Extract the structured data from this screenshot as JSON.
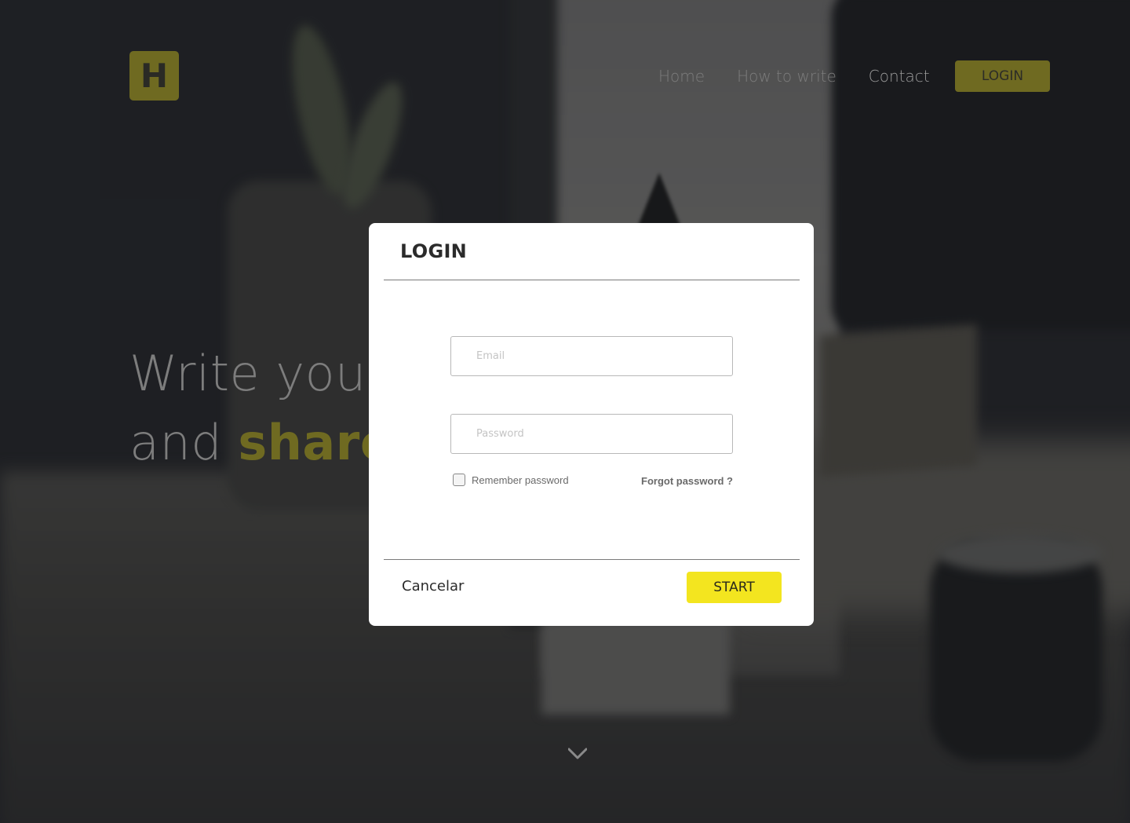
{
  "colors": {
    "accent": "#f3e51f",
    "accent_dimmed": "#6f6a21",
    "overlay": "#24262a",
    "modal_bg": "#ffffff"
  },
  "header": {
    "logo_letter": "H",
    "nav": [
      {
        "label": "Home"
      },
      {
        "label": "How to write"
      },
      {
        "label": "Contact"
      }
    ],
    "login_button": "LOGIN"
  },
  "hero": {
    "line1": "Write your",
    "line2_prefix": "and",
    "line2_strong": "share"
  },
  "scroll_icon": "chevron-down-icon",
  "modal": {
    "title": "LOGIN",
    "email_placeholder": "Email",
    "password_placeholder": "Password",
    "remember_label": "Remember password",
    "remember_checked": false,
    "forgot_label": "Forgot password ?",
    "cancel_label": "Cancelar",
    "start_label": "START"
  }
}
